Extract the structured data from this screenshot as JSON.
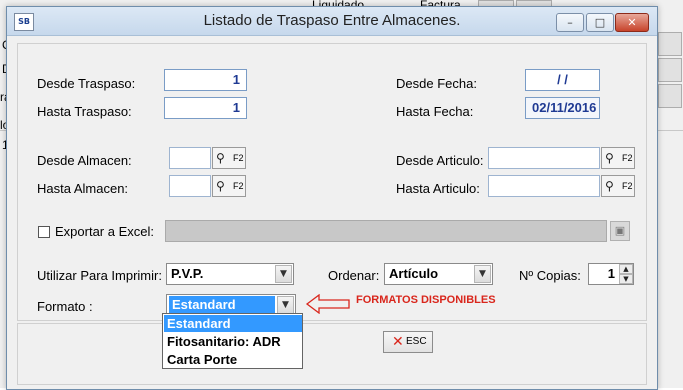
{
  "background": {
    "label_liquidado": "Liquidado",
    "label_factura": "Factura",
    "fragment_c": "C",
    "fragment_d": "D",
    "fragment_ra": "ra",
    "fragment_lo": "lo",
    "fragment_1": "1"
  },
  "window": {
    "title": "Listado de Traspaso Entre Almacenes.",
    "icon_text": "SB",
    "minimize_glyph": "–",
    "maximize_glyph": "□",
    "close_glyph": "✕"
  },
  "form": {
    "desde_traspaso_label": "Desde Traspaso:",
    "desde_traspaso_value": "1",
    "hasta_traspaso_label": "Hasta Traspaso:",
    "hasta_traspaso_value": "1",
    "desde_fecha_label": "Desde Fecha:",
    "desde_fecha_value": "/ /",
    "hasta_fecha_label": "Hasta Fecha:",
    "hasta_fecha_value": "02/11/2016",
    "desde_almacen_label": "Desde Almacen:",
    "hasta_almacen_label": "Hasta Almacen:",
    "desde_articulo_label": "Desde Articulo:",
    "hasta_articulo_label": "Hasta Articulo:",
    "lookup_key": "F2",
    "exportar_label": "Exportar a Excel:",
    "utilizar_label": "Utilizar Para Imprimir:",
    "utilizar_value": "P.V.P.",
    "ordenar_label": "Ordenar:",
    "ordenar_value": "Artículo",
    "copias_label": "Nº Copias:",
    "copias_value": "1",
    "formato_label": "Formato :",
    "formato_value": "Estandard"
  },
  "formato_options": [
    "Estandard",
    "Fitosanitario: ADR",
    "Carta Porte"
  ],
  "annotation": {
    "text": "FORMATOS DISPONIBLES",
    "color": "#d9261c"
  },
  "footer": {
    "esc_label": "ESC"
  },
  "icons": {
    "lookup": "binoculars-icon",
    "save": "floppy-disk-icon",
    "esc": "close-x-icon"
  }
}
